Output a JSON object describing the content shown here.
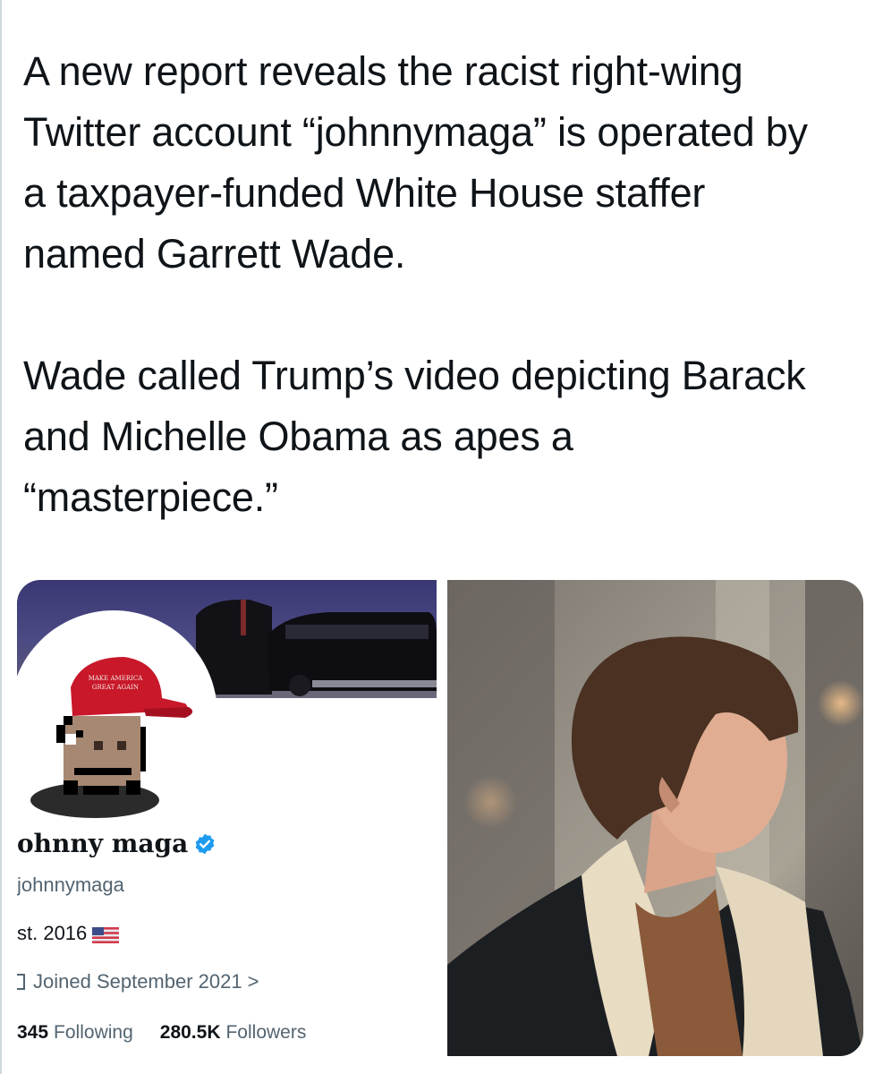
{
  "tweet": {
    "paragraph_1": "A new report reveals the racist right-wing Twitter account “johnnymaga” is operated by a taxpayer-funded White House staffer named Garrett Wade.",
    "paragraph_2": "Wade called Trump’s video depicting Barack and Michelle Obama as apes a “masterpiece.”"
  },
  "profile_card": {
    "display_name": "ohnny maga",
    "handle": "johnnymaga",
    "bio": "st. 2016",
    "joined": "Joined September 2021",
    "joined_chevron": ">",
    "following_count": "345",
    "following_label": "Following",
    "followers_count": "280.5K",
    "followers_label": "Followers"
  },
  "colors": {
    "text_primary": "#0f1419",
    "text_secondary": "#536471",
    "verified_blue": "#1d9bf0",
    "hat_red": "#c8182a"
  },
  "icons": {
    "verified": "verified-badge-icon",
    "flag": "us-flag-icon",
    "calendar": "calendar-icon"
  }
}
